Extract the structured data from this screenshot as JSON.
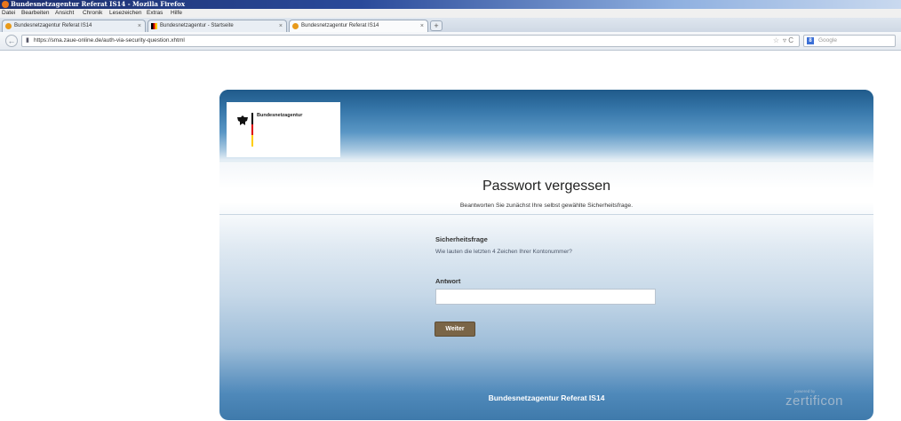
{
  "window": {
    "title": "Bundesnetzagentur Referat IS14 - Mozilla Firefox"
  },
  "menu": [
    "Datei",
    "Bearbeiten",
    "Ansicht",
    "Chronik",
    "Lesezeichen",
    "Extras",
    "Hilfe"
  ],
  "tabs": [
    {
      "label": "Bundesnetzagentur Referat IS14",
      "close": "×"
    },
    {
      "label": "Bundesnetzagentur - Startseite",
      "close": "×"
    },
    {
      "label": "Bundesnetzagentur Referat IS14",
      "close": "×"
    }
  ],
  "new_tab": "+",
  "nav": {
    "back": "←",
    "url": "https://sma.zaue-online.de/auth-via-security-question.xhtml",
    "star": "☆",
    "reload": "▿ C",
    "search_placeholder": "Google",
    "search_engine_letter": "8"
  },
  "logo": {
    "text": "Bundesnetzagentur"
  },
  "page": {
    "title": "Passwort vergessen",
    "subtitle": "Beantworten Sie zunächst Ihre selbst gewählte Sicherheitsfrage.",
    "security_label": "Sicherheitsfrage",
    "security_question": "Wie lauten die letzten 4 Zeichen Ihrer Kontonummer?",
    "answer_label": "Antwort",
    "answer_value": "",
    "submit_label": "Weiter",
    "footer": "Bundesnetzagentur Referat IS14",
    "badge_small": "powered by",
    "badge_name": "zertificon"
  },
  "colors": {
    "button": "#7a6547",
    "header": "#2f6c9c",
    "flag_black": "#000000",
    "flag_red": "#dd0000",
    "flag_gold": "#ffce00"
  }
}
